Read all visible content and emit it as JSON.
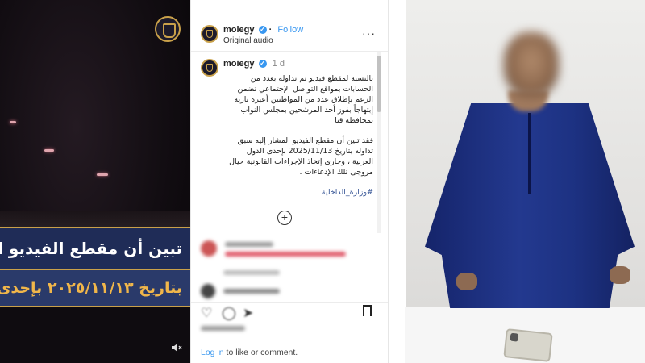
{
  "video": {
    "caption_line1": "تبين أن مقطع الفيديو المش",
    "caption_line2": "بتاريخ ٢٠٢٥/١١/١٣ بإحدى",
    "emblem_icon": "police-emblem-icon",
    "mute_icon": "mute-icon",
    "colors": {
      "caption_bg": "#1f2c57",
      "caption_gold": "#f0b64a"
    }
  },
  "post": {
    "username": "moiegy",
    "follow_label": "Follow",
    "audio_label": "Original audio",
    "caption_username": "moiegy",
    "time_label": "1 d",
    "caption_para1": "بالنسبة لمقطع فيديو تم تداوله بعدد من الحسابات بمواقع التواصل الإجتماعي تضمن الزعم بإطلاق عدد من المواطنين أعيرة نارية إبتهاجاً بفوز أحد المرشحين بمجلس النواب بمحافظة قنا .",
    "caption_para2": "فقد تبين أن مقطع الفيديو المشار إليه سبق تداوله بتاريخ 2025/11/13 بإحدى الدول العربية ، وجارى إتخاذ الإجراءات القانونية حيال مروجى تلك الإدعاءات .",
    "hashtag": "#وزارة_الداخلية",
    "login_link": "Log in",
    "login_rest": " to like or comment.",
    "icons": {
      "more": "more-options-icon",
      "verified": "verified-badge-icon",
      "load_more": "load-more-comments-icon",
      "bookmark": "bookmark-icon"
    },
    "verified_glyph": "✓",
    "more_glyph": "···",
    "load_more_glyph": "+",
    "link_color": "#3897f0"
  },
  "photo": {
    "robe_color": "#23398f"
  }
}
